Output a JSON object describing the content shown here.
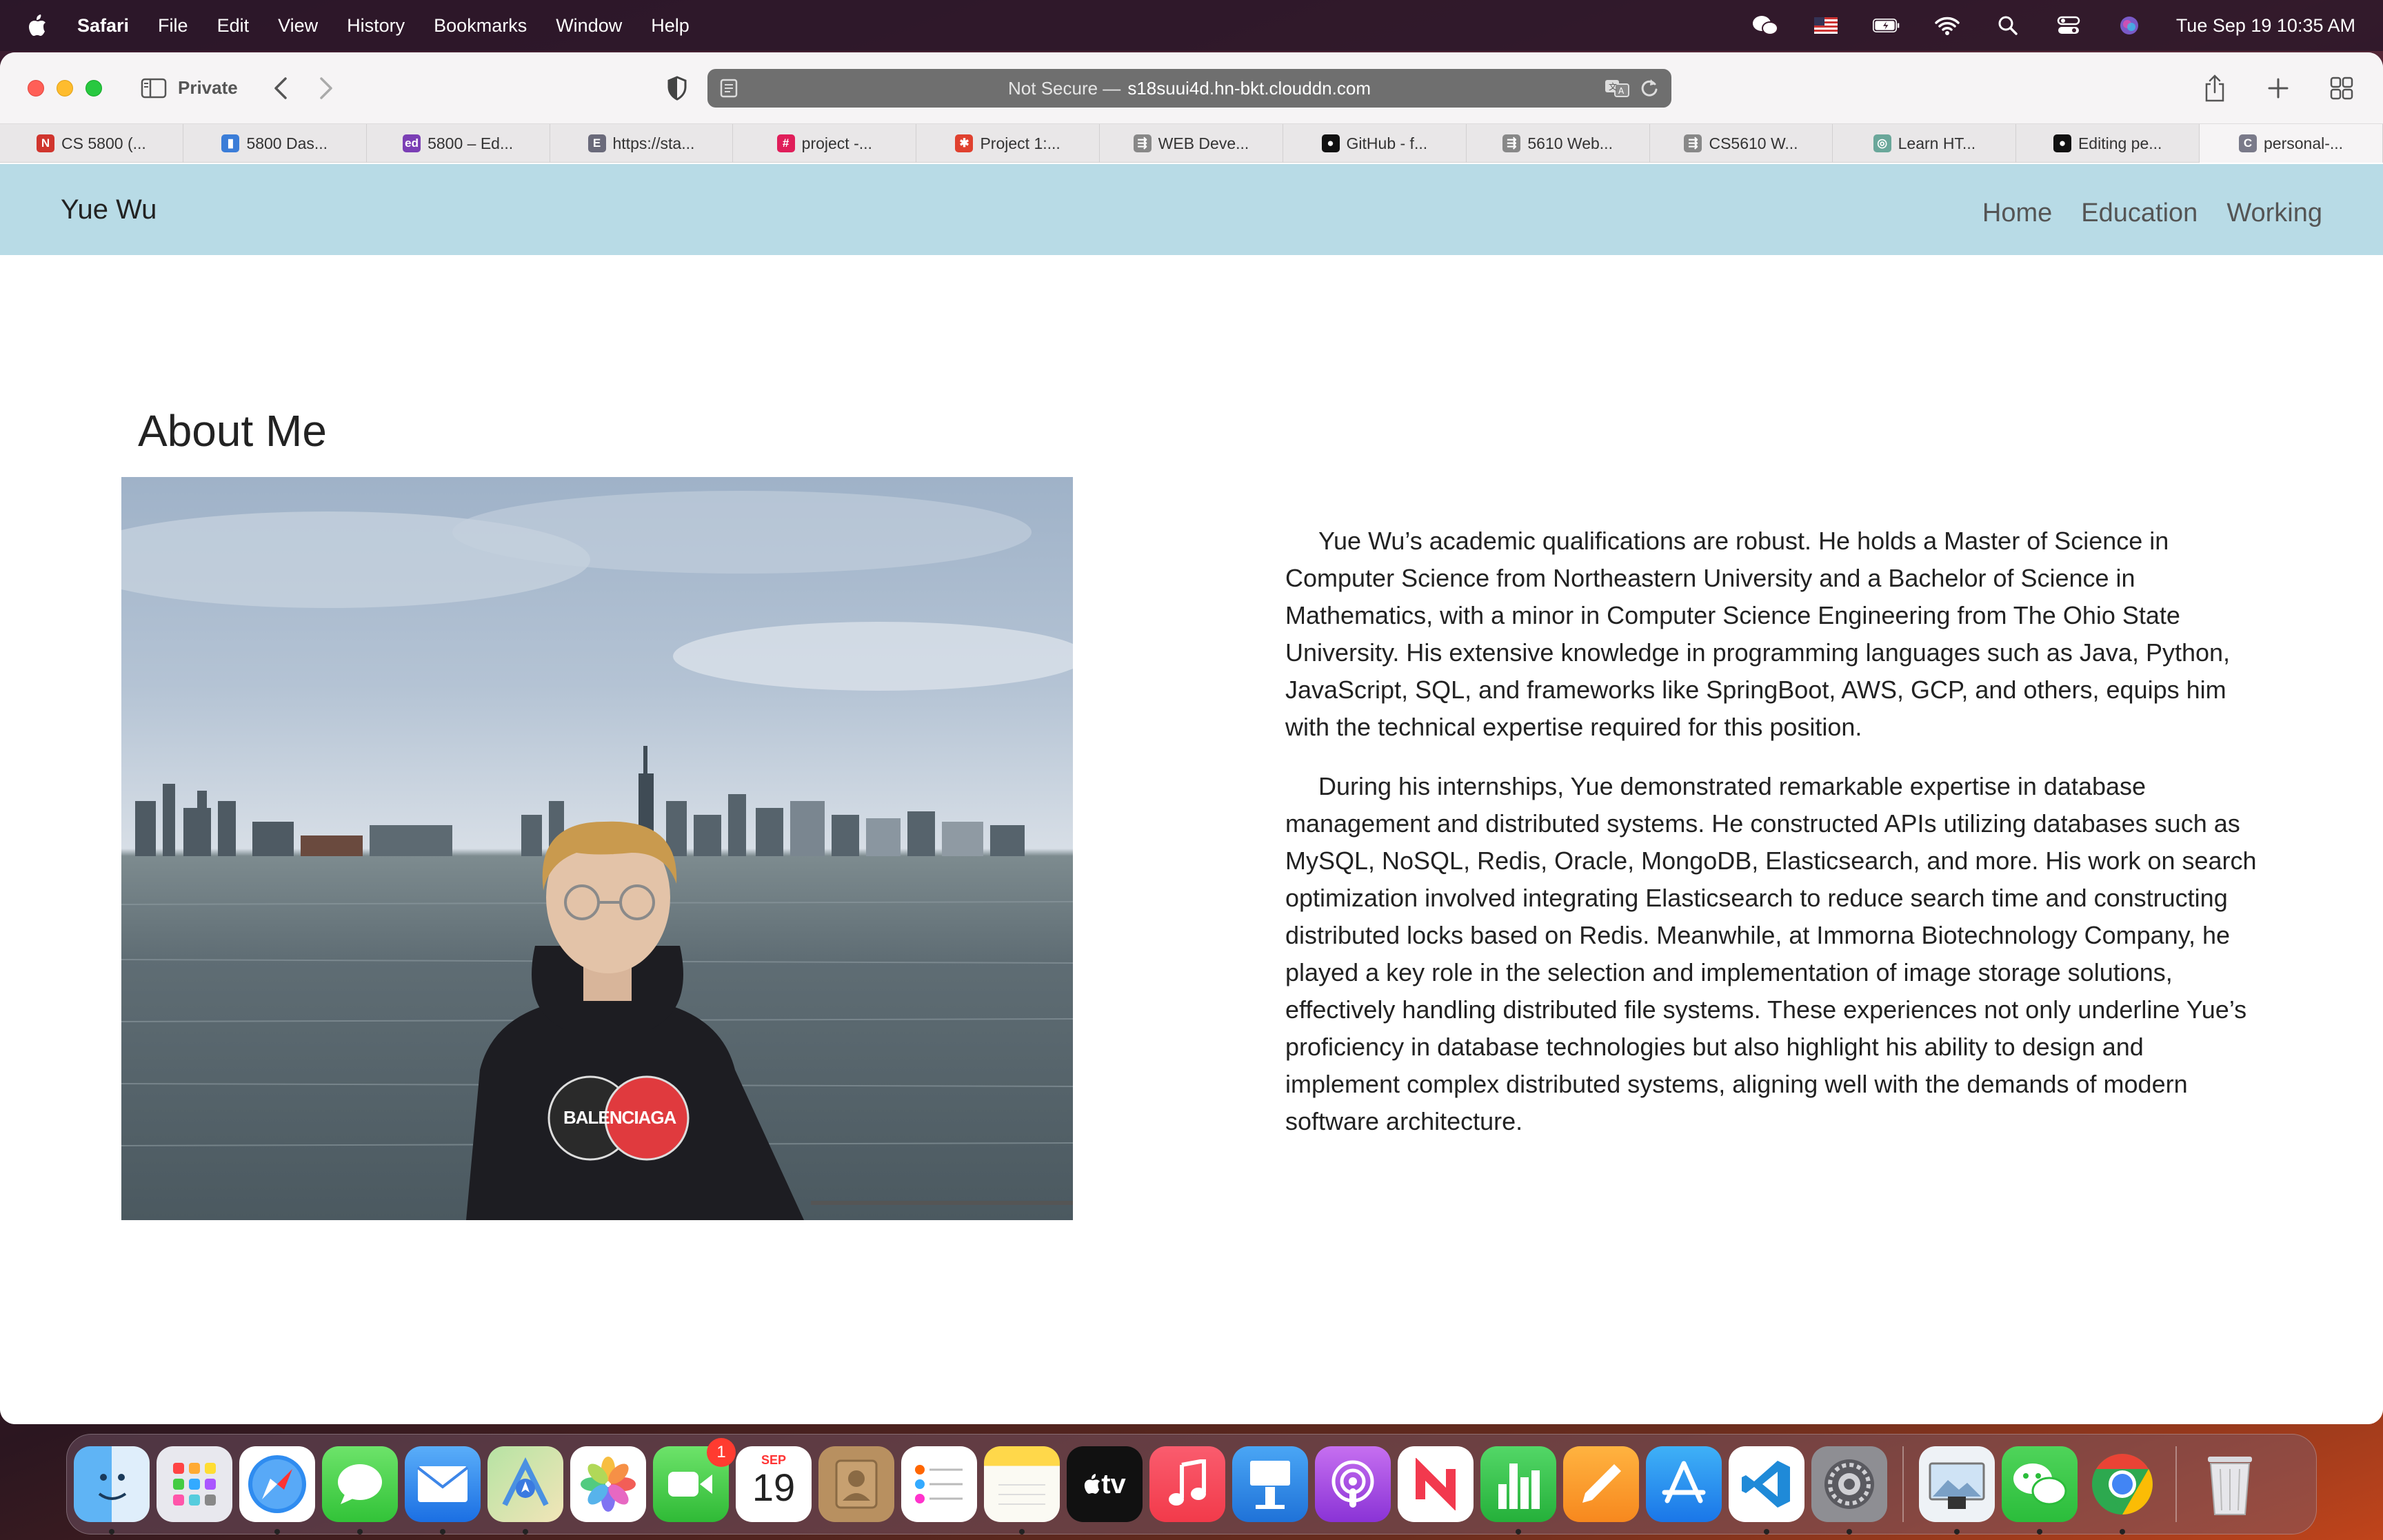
{
  "menubar": {
    "app_name": "Safari",
    "items": [
      "File",
      "Edit",
      "View",
      "History",
      "Bookmarks",
      "Window",
      "Help"
    ],
    "clock": "Tue Sep 19  10:35 AM"
  },
  "browser": {
    "private_label": "Private",
    "url_not_secure": "Not Secure —",
    "url_host": "s18suui4d.hn-bkt.clouddn.com",
    "tabs": [
      {
        "label": "CS 5800 (...",
        "icon_color": "#d0352e",
        "icon_glyph": "N"
      },
      {
        "label": "5800 Das...",
        "icon_color": "#3b7dd8",
        "icon_glyph": "▮"
      },
      {
        "label": "5800 – Ed...",
        "icon_color": "#7b3fb5",
        "icon_glyph": "ed"
      },
      {
        "label": "https://sta...",
        "icon_color": "#6a6a7a",
        "icon_glyph": "E"
      },
      {
        "label": "project -...",
        "icon_color": "#e01e5a",
        "icon_glyph": "#"
      },
      {
        "label": "Project 1:...",
        "icon_color": "#e0412f",
        "icon_glyph": "✱"
      },
      {
        "label": "WEB Deve...",
        "icon_color": "#888888",
        "icon_glyph": "⇶"
      },
      {
        "label": "GitHub - f...",
        "icon_color": "#111111",
        "icon_glyph": "●"
      },
      {
        "label": "5610 Web...",
        "icon_color": "#888888",
        "icon_glyph": "⇶"
      },
      {
        "label": "CS5610 W...",
        "icon_color": "#888888",
        "icon_glyph": "⇶"
      },
      {
        "label": "Learn HT...",
        "icon_color": "#6aa79a",
        "icon_glyph": "◎"
      },
      {
        "label": "Editing pe...",
        "icon_color": "#111111",
        "icon_glyph": "●"
      },
      {
        "label": "personal-...",
        "icon_color": "#7a7a8a",
        "icon_glyph": "C"
      }
    ]
  },
  "site": {
    "brand": "Yue Wu",
    "nav": [
      "Home",
      "Education",
      "Working"
    ],
    "about_title": "About Me",
    "photo_alt": "",
    "bio": [
      "Yue Wu’s academic qualifications are robust. He holds a Master of Science in Computer Science from Northeastern University and a Bachelor of Science in Mathematics, with a minor in Computer Science Engineering from The Ohio State University. His extensive knowledge in programming languages such as Java, Python, JavaScript, SQL, and frameworks like SpringBoot, AWS, GCP, and others, equips him with the technical expertise required for this position.",
      "During his internships, Yue demonstrated remarkable expertise in database management and distributed systems. He constructed APIs utilizing databases such as MySQL, NoSQL, Redis, Oracle, MongoDB, Elasticsearch, and more. His work on search optimization involved integrating Elasticsearch to reduce search time and constructing distributed locks based on Redis. Meanwhile, at Immorna Biotechnology Company, he played a key role in the selection and implementation of image storage solutions, effectively handling distributed file systems. These experiences not only underline Yue’s proficiency in database technologies but also highlight his ability to design and implement complex distributed systems, aligning well with the demands of modern software architecture."
    ],
    "hoodie_text": "BALENCIAGA"
  },
  "dock": {
    "facetime_badge": "1",
    "calendar_month": "SEP",
    "calendar_day": "19",
    "tv_label": "tv"
  }
}
